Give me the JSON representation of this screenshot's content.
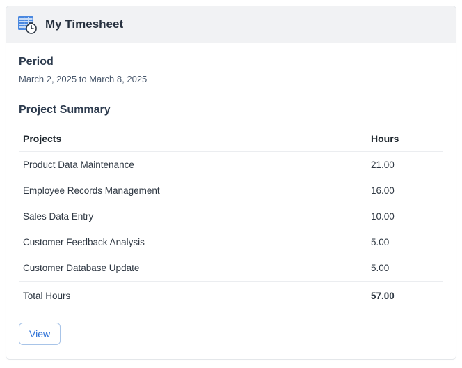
{
  "header": {
    "title": "My Timesheet"
  },
  "period": {
    "label": "Period",
    "text": "March 2, 2025 to March 8, 2025"
  },
  "summary": {
    "title": "Project Summary",
    "columns": {
      "project": "Projects",
      "hours": "Hours"
    },
    "rows": [
      {
        "project": "Product Data Maintenance",
        "hours": "21.00"
      },
      {
        "project": "Employee Records Management",
        "hours": "16.00"
      },
      {
        "project": "Sales Data Entry",
        "hours": "10.00"
      },
      {
        "project": "Customer Feedback Analysis",
        "hours": "5.00"
      },
      {
        "project": "Customer Database Update",
        "hours": "5.00"
      }
    ],
    "total": {
      "label": "Total Hours",
      "hours": "57.00"
    }
  },
  "actions": {
    "view": "View"
  }
}
